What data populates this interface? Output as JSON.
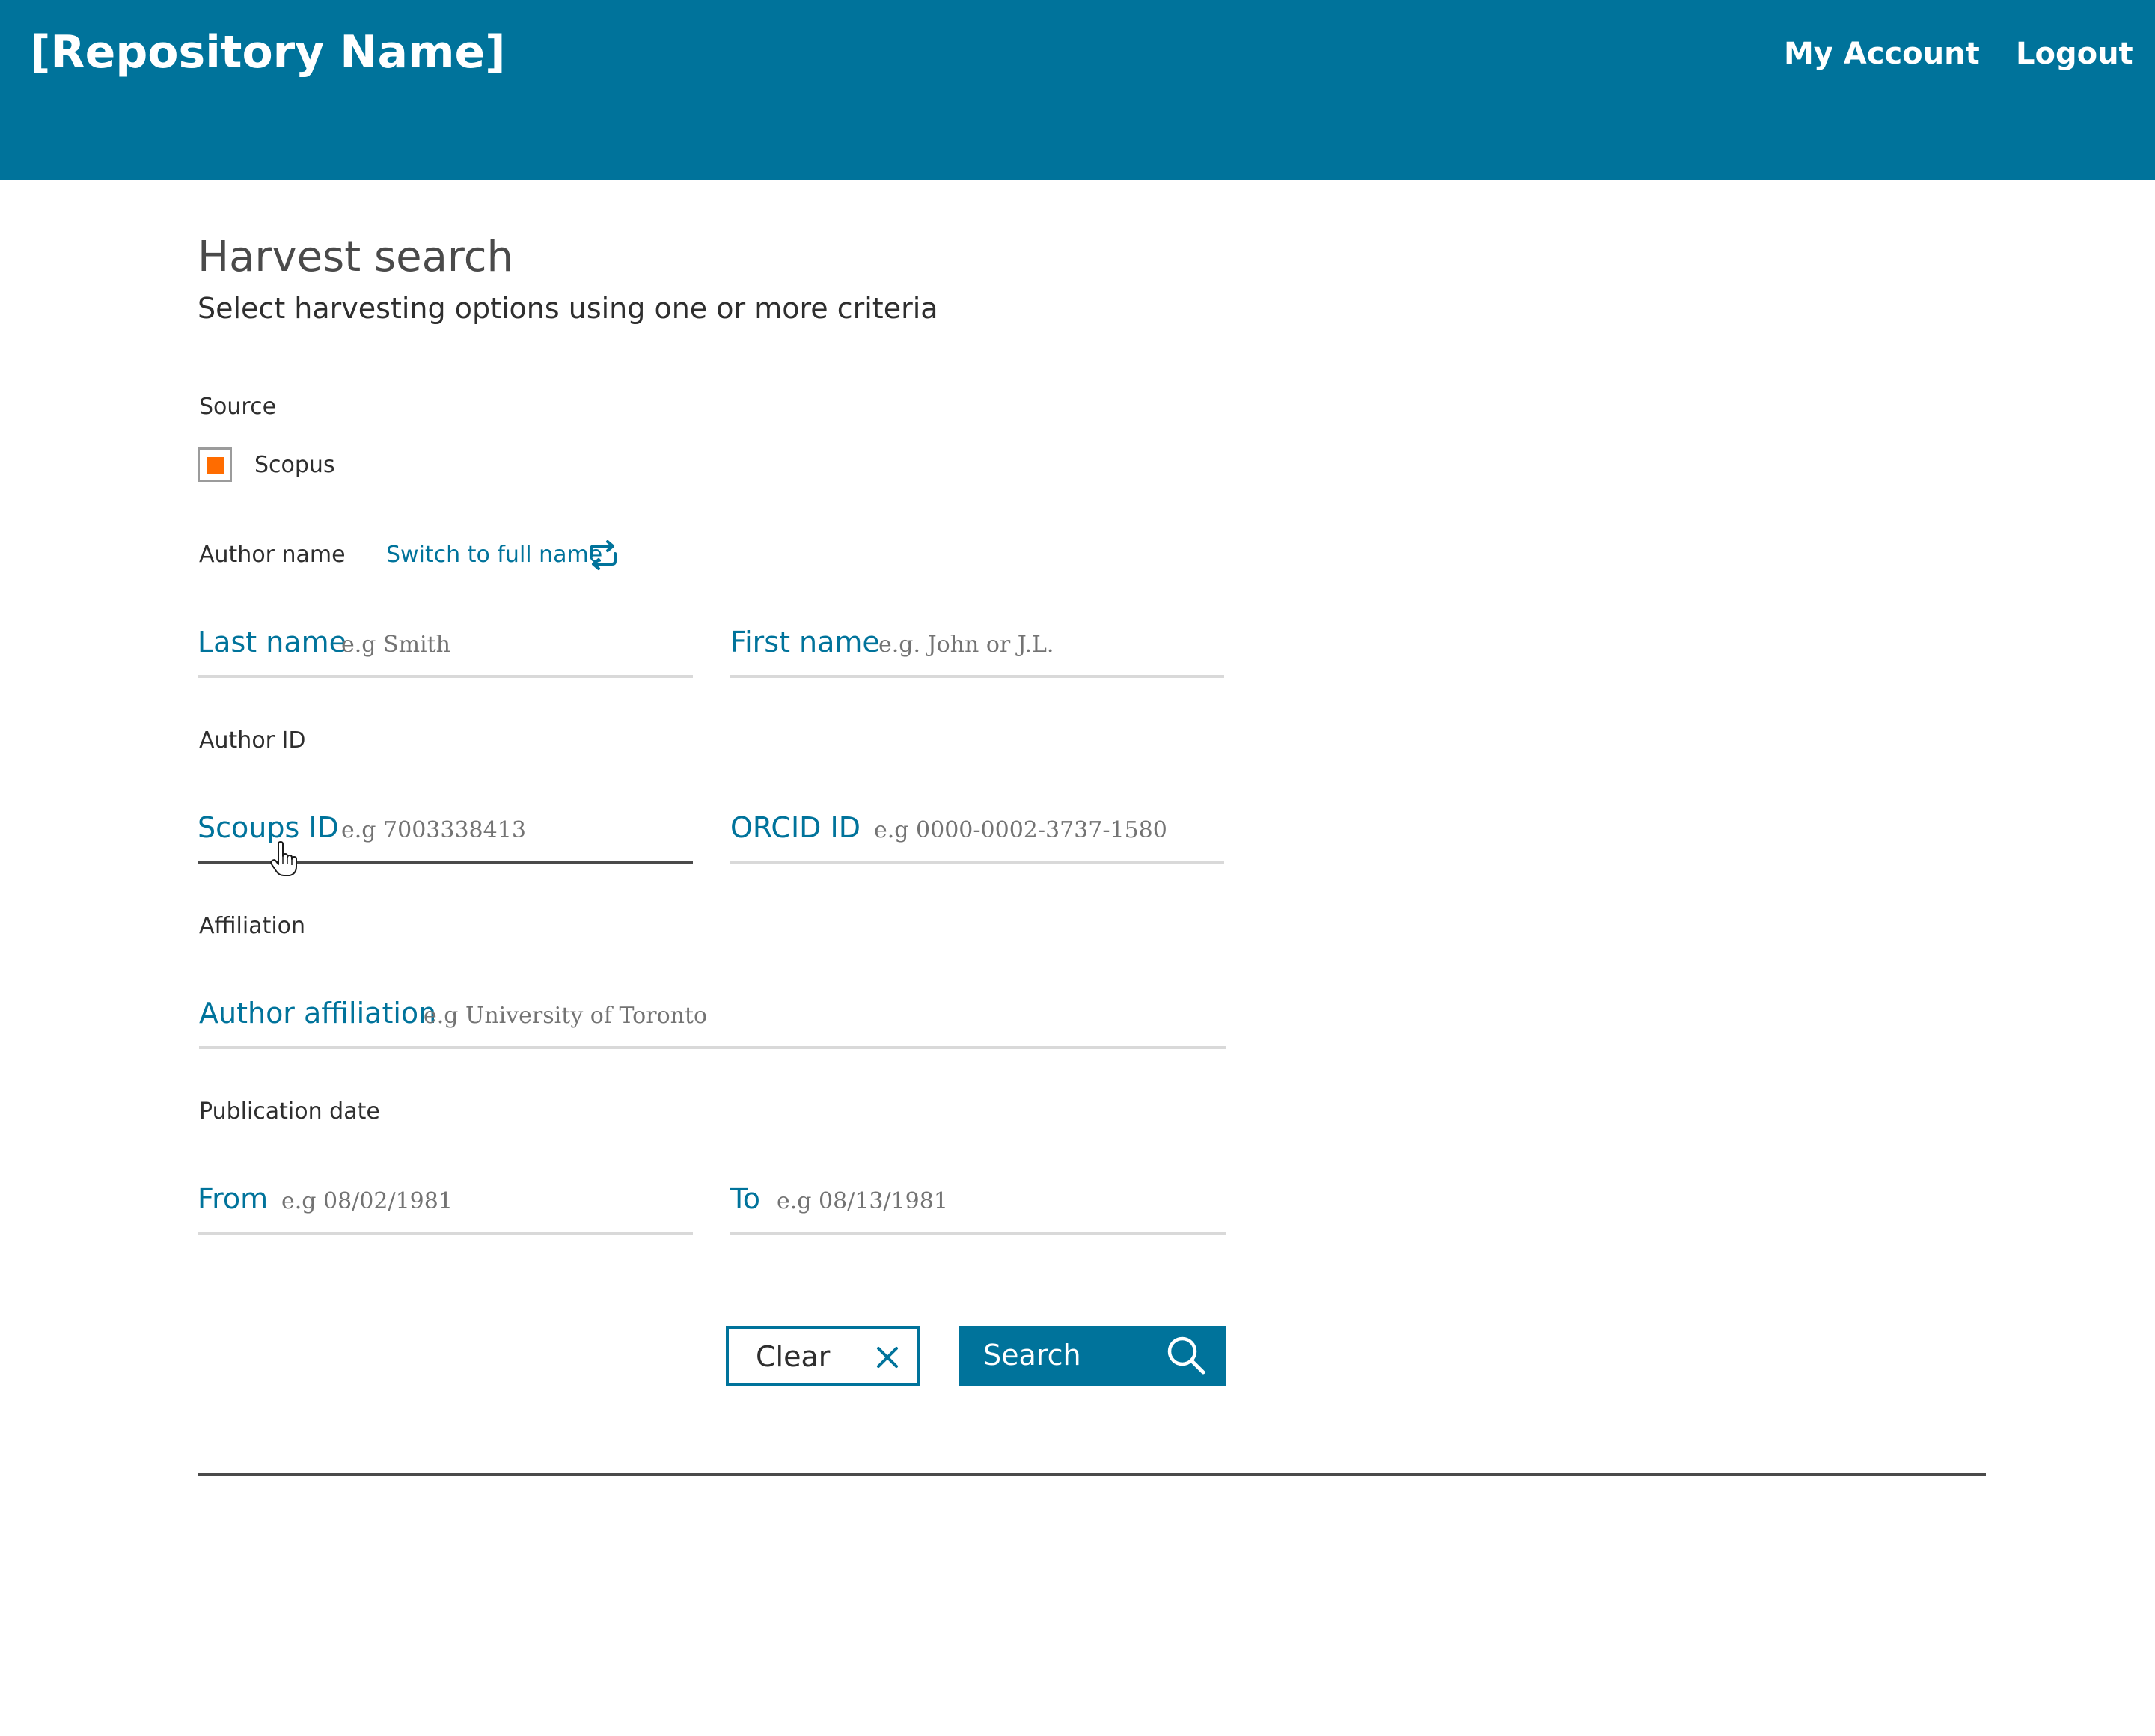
{
  "header": {
    "brand": "[Repository Name]",
    "nav": {
      "my_account": "My Account",
      "logout": "Logout"
    }
  },
  "page": {
    "title": "Harvest search",
    "subtitle": "Select harvesting options using one or more criteria"
  },
  "source": {
    "label": "Source",
    "option": {
      "label": "Scopus",
      "checked": true
    }
  },
  "author_name": {
    "label": "Author name",
    "switch_label": "Switch to full name",
    "last_name": {
      "label": "Last name",
      "placeholder": "e.g Smith",
      "value": ""
    },
    "first_name": {
      "label": "First name",
      "placeholder": "e.g. John or J.L.",
      "value": ""
    }
  },
  "author_id": {
    "label": "Author ID",
    "scopus_id": {
      "label": "Scoups ID",
      "placeholder": "e.g 7003338413",
      "value": ""
    },
    "orcid_id": {
      "label": "ORCID ID",
      "placeholder": "e.g 0000-0002-3737-1580",
      "value": ""
    }
  },
  "affiliation": {
    "label": "Affiliation",
    "author_affiliation": {
      "label": "Author affiliation",
      "placeholder": "e.g University of Toronto",
      "value": ""
    }
  },
  "publication_date": {
    "label": "Publication date",
    "from": {
      "label": "From",
      "placeholder": "e.g 08/02/1981",
      "value": ""
    },
    "to": {
      "label": "To",
      "placeholder": "e.g 08/13/1981",
      "value": ""
    }
  },
  "actions": {
    "clear_label": "Clear",
    "search_label": "Search"
  },
  "colors": {
    "brand": "#00739b",
    "accent": "#ff6c00",
    "text": "#2e2e2e",
    "muted": "#737373",
    "border": "#d9d9d9"
  },
  "icons": {
    "switch": "refresh-icon",
    "clear": "close-icon",
    "search": "search-icon",
    "cursor": "hand-cursor-icon"
  }
}
